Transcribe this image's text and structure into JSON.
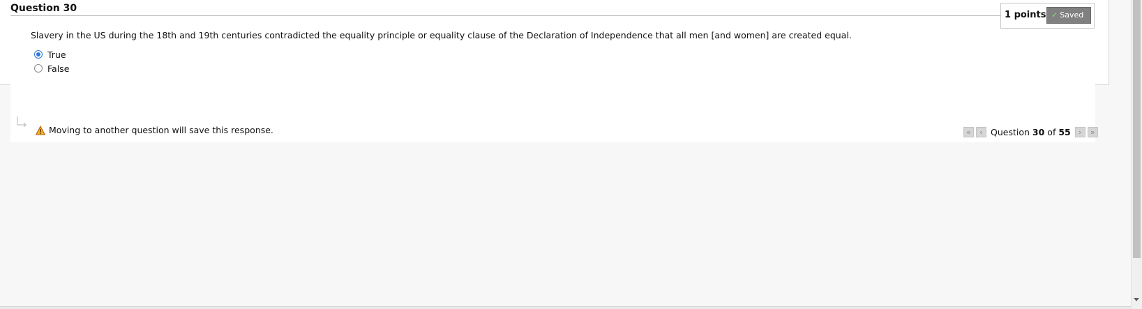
{
  "question": {
    "title": "Question 30",
    "points": "1 points",
    "saved_label": "Saved",
    "text": "Slavery in the US during the 18th and 19th centuries contradicted the equality principle or equality clause of the Declaration of Independence that all men [and women] are created equal.",
    "options": [
      {
        "label": "True",
        "selected": true
      },
      {
        "label": "False",
        "selected": false
      }
    ]
  },
  "footer": {
    "warning": "Moving to another question will save this response.",
    "pager": {
      "prefix": "Question",
      "current": "30",
      "of_label": "of",
      "total": "55"
    }
  },
  "colors": {
    "accent": "#2d7ad6",
    "saved_badge": "#808080",
    "saved_check": "#7fe36f",
    "warning": "#e8a317"
  },
  "icons": [
    "check-icon",
    "arrow-return-icon",
    "warning-icon",
    "first-page-icon",
    "prev-page-icon",
    "next-page-icon",
    "last-page-icon"
  ]
}
